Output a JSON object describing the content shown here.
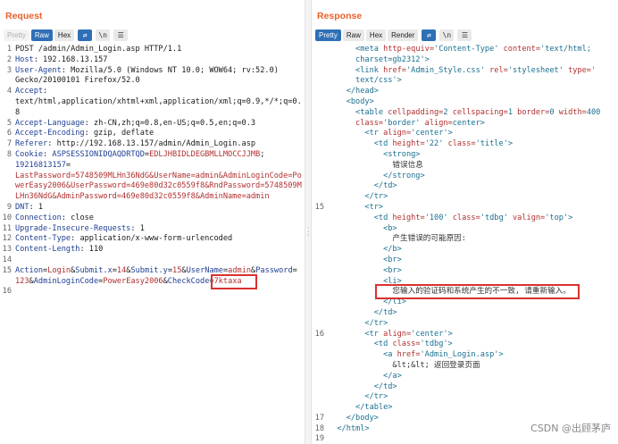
{
  "request": {
    "title": "Request",
    "tabs": [
      "Pretty",
      "Raw",
      "Hex"
    ],
    "icons": [
      "wrap-icon",
      "newline-icon",
      "menu-icon"
    ],
    "lines": [
      {
        "n": "1",
        "segments": [
          {
            "t": "POST /admin/Admin_Login.asp HTTP/1.1",
            "c": ""
          }
        ]
      },
      {
        "n": "2",
        "segments": [
          {
            "t": "Host",
            "c": "k"
          },
          {
            "t": ": 192.168.13.157",
            "c": ""
          }
        ]
      },
      {
        "n": "3",
        "segments": [
          {
            "t": "User-Agent",
            "c": "k"
          },
          {
            "t": ": Mozilla/5.0 (Windows NT 10.0; WOW64; rv:52.0)",
            "c": ""
          }
        ]
      },
      {
        "n": "",
        "segments": [
          {
            "t": "Gecko/20100101 Firefox/52.0",
            "c": ""
          }
        ]
      },
      {
        "n": "4",
        "segments": [
          {
            "t": "Accept",
            "c": "k"
          },
          {
            "t": ":",
            "c": ""
          }
        ]
      },
      {
        "n": "",
        "segments": [
          {
            "t": "text/html,application/xhtml+xml,application/xml;q=0.9,*/*;q=0.",
            "c": ""
          }
        ]
      },
      {
        "n": "",
        "segments": [
          {
            "t": "8",
            "c": ""
          }
        ]
      },
      {
        "n": "5",
        "segments": [
          {
            "t": "Accept-Language",
            "c": "k"
          },
          {
            "t": ": zh-CN,zh;q=0.8,en-US;q=0.5,en;q=0.3",
            "c": ""
          }
        ]
      },
      {
        "n": "6",
        "segments": [
          {
            "t": "Accept-Encoding",
            "c": "k"
          },
          {
            "t": ": gzip, deflate",
            "c": ""
          }
        ]
      },
      {
        "n": "7",
        "segments": [
          {
            "t": "Referer",
            "c": "k"
          },
          {
            "t": ": http://192.168.13.157/admin/Admin_Login.asp",
            "c": ""
          }
        ]
      },
      {
        "n": "8",
        "segments": [
          {
            "t": "Cookie",
            "c": "k"
          },
          {
            "t": ": ",
            "c": ""
          },
          {
            "t": "ASPSESSIONIDQAQDRTQD",
            "c": "k"
          },
          {
            "t": "=",
            "c": ""
          },
          {
            "t": "EDLJHBIDLDEGBMLLMOCCJJMB",
            "c": "v"
          },
          {
            "t": ";",
            "c": ""
          }
        ]
      },
      {
        "n": "",
        "segments": [
          {
            "t": "19216813157",
            "c": "k"
          },
          {
            "t": "=",
            "c": ""
          }
        ]
      },
      {
        "n": "",
        "segments": [
          {
            "t": "LastPassword=5748509MLHn36NdG&UserName=admin&AdminLoginCode=Po",
            "c": "v"
          }
        ]
      },
      {
        "n": "",
        "segments": [
          {
            "t": "werEasy2006&UserPassword=469e80d32c0559f8&RndPassword=5748509M",
            "c": "v"
          }
        ]
      },
      {
        "n": "",
        "segments": [
          {
            "t": "LHn36NdG&AdminPassword=469e80d32c0559f8&AdminName=admin",
            "c": "v"
          }
        ]
      },
      {
        "n": "9",
        "segments": [
          {
            "t": "DNT",
            "c": "k"
          },
          {
            "t": ": 1",
            "c": ""
          }
        ]
      },
      {
        "n": "10",
        "segments": [
          {
            "t": "Connection",
            "c": "k"
          },
          {
            "t": ": close",
            "c": ""
          }
        ]
      },
      {
        "n": "11",
        "segments": [
          {
            "t": "Upgrade-Insecure-Requests",
            "c": "k"
          },
          {
            "t": ": 1",
            "c": ""
          }
        ]
      },
      {
        "n": "12",
        "segments": [
          {
            "t": "Content-Type",
            "c": "k"
          },
          {
            "t": ": application/x-www-form-urlencoded",
            "c": ""
          }
        ]
      },
      {
        "n": "13",
        "segments": [
          {
            "t": "Content-Length",
            "c": "k"
          },
          {
            "t": ": 110",
            "c": ""
          }
        ]
      },
      {
        "n": "14",
        "segments": [
          {
            "t": "",
            "c": ""
          }
        ]
      },
      {
        "n": "15",
        "segments": [
          {
            "t": "Action",
            "c": "k"
          },
          {
            "t": "=",
            "c": ""
          },
          {
            "t": "Login",
            "c": "v"
          },
          {
            "t": "&",
            "c": ""
          },
          {
            "t": "Submit.x",
            "c": "k"
          },
          {
            "t": "=",
            "c": ""
          },
          {
            "t": "14",
            "c": "v"
          },
          {
            "t": "&",
            "c": ""
          },
          {
            "t": "Submit.y",
            "c": "k"
          },
          {
            "t": "=",
            "c": ""
          },
          {
            "t": "15",
            "c": "v"
          },
          {
            "t": "&",
            "c": ""
          },
          {
            "t": "UserName",
            "c": "k"
          },
          {
            "t": "=",
            "c": ""
          },
          {
            "t": "admin",
            "c": "v"
          },
          {
            "t": "&",
            "c": ""
          },
          {
            "t": "Password",
            "c": "k"
          },
          {
            "t": "=",
            "c": ""
          }
        ]
      },
      {
        "n": "",
        "segments": [
          {
            "t": "123",
            "c": "v"
          },
          {
            "t": "&",
            "c": ""
          },
          {
            "t": "AdminLoginCode",
            "c": "k"
          },
          {
            "t": "=",
            "c": ""
          },
          {
            "t": "PowerEasy2006",
            "c": "v"
          },
          {
            "t": "&",
            "c": ""
          },
          {
            "t": "CheckCode",
            "c": "k"
          },
          {
            "t": "=",
            "c": ""
          },
          {
            "t": "7ktaxa",
            "c": "v"
          }
        ]
      },
      {
        "n": "16",
        "segments": [
          {
            "t": "",
            "c": ""
          }
        ]
      }
    ]
  },
  "response": {
    "title": "Response",
    "tabs": [
      "Pretty",
      "Raw",
      "Hex",
      "Render"
    ],
    "icons": [
      "wrap-icon",
      "newline-icon",
      "menu-icon"
    ],
    "lines": [
      {
        "n": "",
        "segments": [
          {
            "t": "      <",
            "c": "tg"
          },
          {
            "t": "meta",
            "c": "tg"
          },
          {
            "t": " http-equiv=",
            "c": "at"
          },
          {
            "t": "'Content-Type'",
            "c": "tg"
          },
          {
            "t": " content=",
            "c": "at"
          },
          {
            "t": "'text/html;",
            "c": "tg"
          }
        ]
      },
      {
        "n": "",
        "segments": [
          {
            "t": "      charset=gb2312'",
            "c": "tg"
          },
          {
            "t": ">",
            "c": "tg"
          }
        ]
      },
      {
        "n": "",
        "segments": [
          {
            "t": "      <",
            "c": "tg"
          },
          {
            "t": "link",
            "c": "tg"
          },
          {
            "t": " href=",
            "c": "at"
          },
          {
            "t": "'Admin_Style.css'",
            "c": "tg"
          },
          {
            "t": " rel=",
            "c": "at"
          },
          {
            "t": "'stylesheet'",
            "c": "tg"
          },
          {
            "t": " type=",
            "c": "at"
          },
          {
            "t": "'",
            "c": "tg"
          }
        ]
      },
      {
        "n": "",
        "segments": [
          {
            "t": "      text/css'",
            "c": "tg"
          },
          {
            "t": ">",
            "c": "tg"
          }
        ]
      },
      {
        "n": "",
        "segments": [
          {
            "t": "    </head>",
            "c": "tg"
          }
        ]
      },
      {
        "n": "",
        "segments": [
          {
            "t": "    <body>",
            "c": "tg"
          }
        ]
      },
      {
        "n": "",
        "segments": [
          {
            "t": "      <",
            "c": "tg"
          },
          {
            "t": "table",
            "c": "tg"
          },
          {
            "t": " cellpadding=",
            "c": "at"
          },
          {
            "t": "2",
            "c": "tg"
          },
          {
            "t": " cellspacing=",
            "c": "at"
          },
          {
            "t": "1",
            "c": "tg"
          },
          {
            "t": " border=",
            "c": "at"
          },
          {
            "t": "0",
            "c": "tg"
          },
          {
            "t": " width=",
            "c": "at"
          },
          {
            "t": "400",
            "c": "tg"
          }
        ]
      },
      {
        "n": "",
        "segments": [
          {
            "t": "      class=",
            "c": "at"
          },
          {
            "t": "'border'",
            "c": "tg"
          },
          {
            "t": " align=",
            "c": "at"
          },
          {
            "t": "center",
            "c": "tg"
          },
          {
            "t": ">",
            "c": "tg"
          }
        ]
      },
      {
        "n": "",
        "segments": [
          {
            "t": "        <",
            "c": "tg"
          },
          {
            "t": "tr",
            "c": "tg"
          },
          {
            "t": " align=",
            "c": "at"
          },
          {
            "t": "'center'",
            "c": "tg"
          },
          {
            "t": ">",
            "c": "tg"
          }
        ]
      },
      {
        "n": "",
        "segments": [
          {
            "t": "          <",
            "c": "tg"
          },
          {
            "t": "td",
            "c": "tg"
          },
          {
            "t": " height=",
            "c": "at"
          },
          {
            "t": "'22'",
            "c": "tg"
          },
          {
            "t": " class=",
            "c": "at"
          },
          {
            "t": "'title'",
            "c": "tg"
          },
          {
            "t": ">",
            "c": "tg"
          }
        ]
      },
      {
        "n": "",
        "segments": [
          {
            "t": "            <strong>",
            "c": "tg"
          }
        ]
      },
      {
        "n": "",
        "segments": [
          {
            "t": "              错误信息",
            "c": "cn"
          }
        ]
      },
      {
        "n": "",
        "segments": [
          {
            "t": "            </strong>",
            "c": "tg"
          }
        ]
      },
      {
        "n": "",
        "segments": [
          {
            "t": "          </td>",
            "c": "tg"
          }
        ]
      },
      {
        "n": "",
        "segments": [
          {
            "t": "        </tr>",
            "c": "tg"
          }
        ]
      },
      {
        "n": "15",
        "segments": [
          {
            "t": "        <tr>",
            "c": "tg"
          }
        ]
      },
      {
        "n": "",
        "segments": [
          {
            "t": "          <",
            "c": "tg"
          },
          {
            "t": "td",
            "c": "tg"
          },
          {
            "t": " height=",
            "c": "at"
          },
          {
            "t": "'100'",
            "c": "tg"
          },
          {
            "t": " class=",
            "c": "at"
          },
          {
            "t": "'tdbg'",
            "c": "tg"
          },
          {
            "t": " valign=",
            "c": "at"
          },
          {
            "t": "'top'",
            "c": "tg"
          },
          {
            "t": ">",
            "c": "tg"
          }
        ]
      },
      {
        "n": "",
        "segments": [
          {
            "t": "            <b>",
            "c": "tg"
          }
        ]
      },
      {
        "n": "",
        "segments": [
          {
            "t": "              产生错误的可能原因:",
            "c": "cn"
          }
        ]
      },
      {
        "n": "",
        "segments": [
          {
            "t": "            </b>",
            "c": "tg"
          }
        ]
      },
      {
        "n": "",
        "segments": [
          {
            "t": "            <br>",
            "c": "tg"
          }
        ]
      },
      {
        "n": "",
        "segments": [
          {
            "t": "            <br>",
            "c": "tg"
          }
        ]
      },
      {
        "n": "",
        "segments": [
          {
            "t": "            <li>",
            "c": "tg"
          }
        ]
      },
      {
        "n": "",
        "segments": [
          {
            "t": "              您输入的验证码和系统产生的不一致, 请重新输入。",
            "c": "cn"
          }
        ]
      },
      {
        "n": "",
        "segments": [
          {
            "t": "            </li>",
            "c": "tg"
          }
        ]
      },
      {
        "n": "",
        "segments": [
          {
            "t": "          </td>",
            "c": "tg"
          }
        ]
      },
      {
        "n": "",
        "segments": [
          {
            "t": "        </tr>",
            "c": "tg"
          }
        ]
      },
      {
        "n": "16",
        "segments": [
          {
            "t": "        <",
            "c": "tg"
          },
          {
            "t": "tr",
            "c": "tg"
          },
          {
            "t": " align=",
            "c": "at"
          },
          {
            "t": "'center'",
            "c": "tg"
          },
          {
            "t": ">",
            "c": "tg"
          }
        ]
      },
      {
        "n": "",
        "segments": [
          {
            "t": "          <",
            "c": "tg"
          },
          {
            "t": "td",
            "c": "tg"
          },
          {
            "t": " class=",
            "c": "at"
          },
          {
            "t": "'tdbg'",
            "c": "tg"
          },
          {
            "t": ">",
            "c": "tg"
          }
        ]
      },
      {
        "n": "",
        "segments": [
          {
            "t": "            <",
            "c": "tg"
          },
          {
            "t": "a",
            "c": "tg"
          },
          {
            "t": " href=",
            "c": "at"
          },
          {
            "t": "'Admin_Login.asp'",
            "c": "tg"
          },
          {
            "t": ">",
            "c": "tg"
          }
        ]
      },
      {
        "n": "",
        "segments": [
          {
            "t": "              &lt;&lt; 返回登录页面",
            "c": "cn"
          }
        ]
      },
      {
        "n": "",
        "segments": [
          {
            "t": "            </a>",
            "c": "tg"
          }
        ]
      },
      {
        "n": "",
        "segments": [
          {
            "t": "          </td>",
            "c": "tg"
          }
        ]
      },
      {
        "n": "",
        "segments": [
          {
            "t": "        </tr>",
            "c": "tg"
          }
        ]
      },
      {
        "n": "",
        "segments": [
          {
            "t": "      </table>",
            "c": "tg"
          }
        ]
      },
      {
        "n": "17",
        "segments": [
          {
            "t": "    </body>",
            "c": "tg"
          }
        ]
      },
      {
        "n": "18",
        "segments": [
          {
            "t": "  </html>",
            "c": "tg"
          }
        ]
      },
      {
        "n": "19",
        "segments": [
          {
            "t": "",
            "c": "tg"
          }
        ]
      }
    ]
  },
  "watermark": "CSDN @出顾茅庐",
  "colors": {
    "accent": "#e8612c",
    "active_tab": "#2f6fb6",
    "highlight_box": "#d8322f"
  }
}
